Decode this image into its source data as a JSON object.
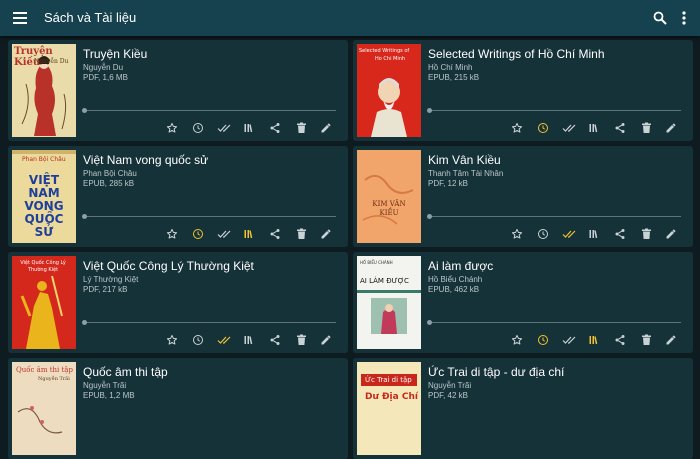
{
  "app": {
    "title": "Sách và Tài liệu"
  },
  "icons": {
    "menu": "menu-icon",
    "search": "search-icon",
    "more": "more-vert-icon",
    "actions": [
      "star-icon",
      "clock-icon",
      "done-all-icon",
      "books-icon",
      "share-icon",
      "delete-icon",
      "edit-icon"
    ]
  },
  "colors": {
    "appbar": "#16414f",
    "background": "#0e1c22",
    "card": "#163239",
    "icon_default": "#c9d3d5",
    "icon_active": "#f2c230"
  },
  "books": [
    {
      "title": "Truyện Kiều",
      "author": "Nguyễn Du",
      "meta": "PDF, 1,6 MB",
      "cover_title": "Truyện Kiều",
      "cover_sub": "Nguyễn Du",
      "active": []
    },
    {
      "title": "Selected Writings of Hồ Chí Minh",
      "author": "Hồ Chí Minh",
      "meta": "EPUB, 215 kB",
      "cover_title": "Selected Writings of",
      "cover_sub": "Ho Chi Minh",
      "active": [
        "clock"
      ]
    },
    {
      "title": "Việt Nam vong quốc sử",
      "author": "Phan Bội Châu",
      "meta": "EPUB, 285 kB",
      "cover_title": "VIỆT NAM VONG QUỐC SỬ",
      "cover_sub": "Phan Bội Châu",
      "active": [
        "clock",
        "books"
      ]
    },
    {
      "title": "Kim Vân Kiều",
      "author": "Thanh Tâm Tài Nhân",
      "meta": "PDF, 12 kB",
      "cover_title": "KIM VÂN KIỀU",
      "cover_sub": "",
      "active": [
        "done"
      ]
    },
    {
      "title": "Việt Quốc Công Lý Thường Kiệt",
      "author": "Lý Thường Kiệt",
      "meta": "PDF, 217 kB",
      "cover_title": "Việt Quốc Công Lý Thường Kiệt",
      "cover_sub": "",
      "active": [
        "done"
      ]
    },
    {
      "title": "Ai làm được",
      "author": "Hồ Biểu Chánh",
      "meta": "EPUB, 462 kB",
      "cover_title": "AI LÀM ĐƯỢC",
      "cover_sub": "HỒ BIỂU CHÁNH",
      "active": [
        "clock",
        "books"
      ]
    },
    {
      "title": "Quốc âm thi tập",
      "author": "Nguyễn Trãi",
      "meta": "EPUB, 1,2 MB",
      "cover_title": "Quốc âm thi tập",
      "cover_sub": "Nguyễn Trãi",
      "active": []
    },
    {
      "title": "Ức Trai di tập - dư địa chí",
      "author": "Nguyễn Trãi",
      "meta": "PDF, 42 kB",
      "cover_title": "Ức Trai di tập",
      "cover_sub": "Dư Địa Chí",
      "active": []
    }
  ]
}
